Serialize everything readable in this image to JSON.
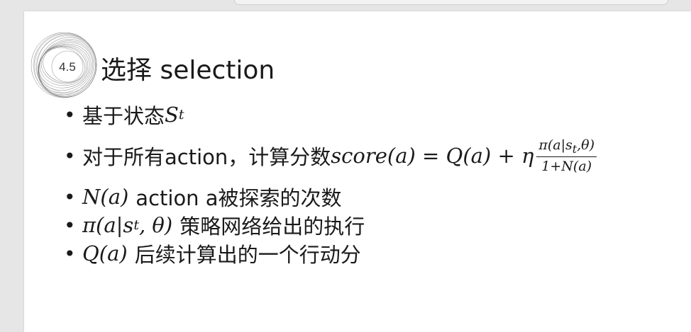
{
  "section": {
    "number": "4.5",
    "title": "选择 selection"
  },
  "bullets": {
    "b1": {
      "text": "基于状态",
      "math_var": "S",
      "math_sub": "t"
    },
    "b2": {
      "text": "对于所有action，计算分数",
      "math_lhs": "score(a) = Q(a) + η",
      "frac_num": "π(a|s",
      "frac_num_sub": "t",
      "frac_num_tail": ",θ)",
      "frac_den": "1+N(a)"
    },
    "b3": {
      "math": "N(a)",
      "text": "action a被探索的次数"
    },
    "b4": {
      "math_pre": "π(a|s",
      "math_sub": "t",
      "math_post": ", θ)",
      "text": "策略网络给出的执行"
    },
    "b5": {
      "math": "Q(a)",
      "text": "后续计算出的一个行动分"
    }
  }
}
